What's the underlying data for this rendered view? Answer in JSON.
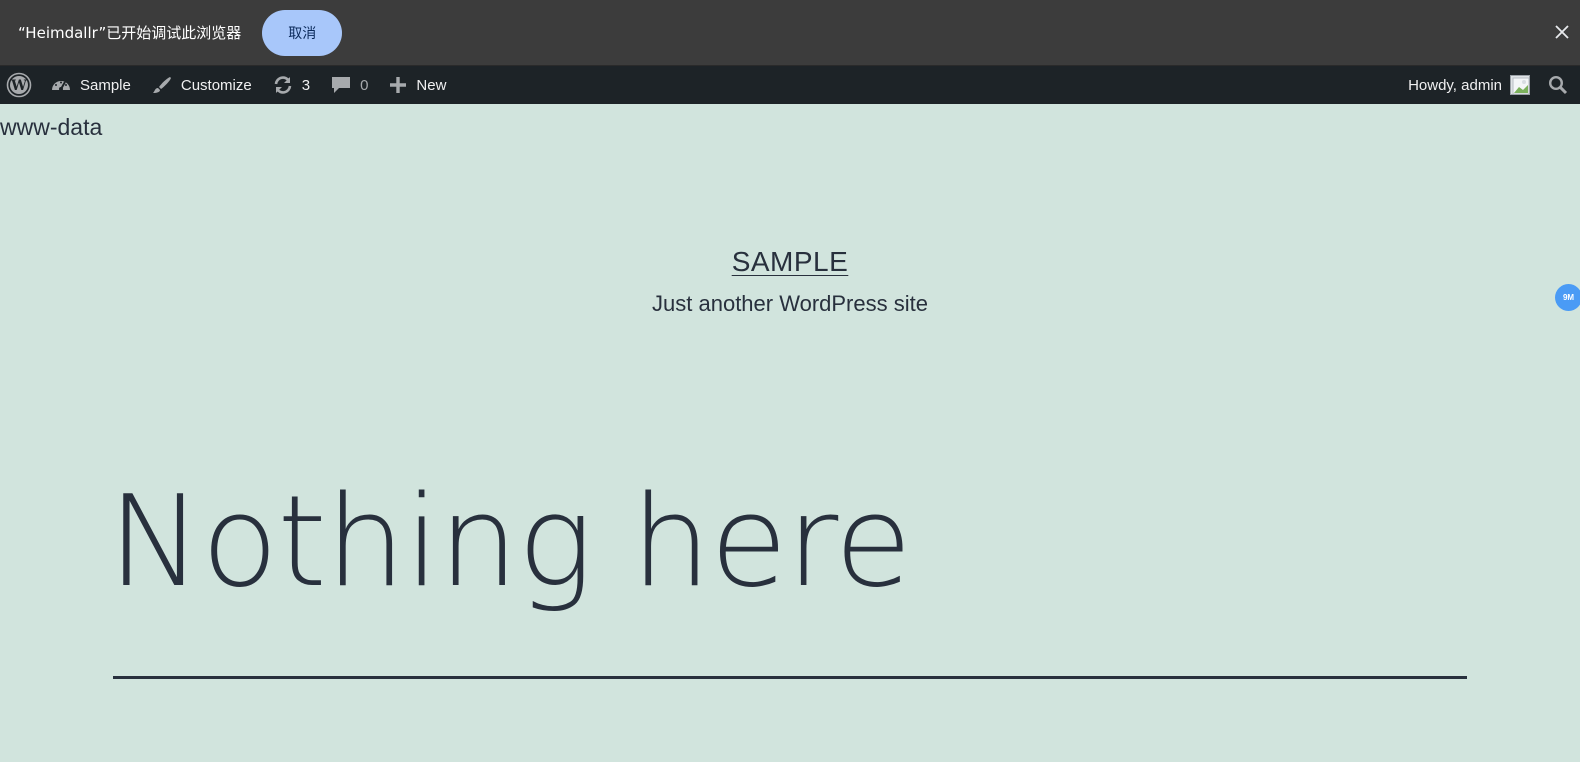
{
  "infobar": {
    "message": "“Heimdallr”已开始调试此浏览器",
    "cancel_label": "取消"
  },
  "adminbar": {
    "site_label": "Sample",
    "customize_label": "Customize",
    "updates_count": "3",
    "comments_count": "0",
    "new_label": "New",
    "howdy_label": "Howdy, admin"
  },
  "page": {
    "user_text": "www-data",
    "site_title": "SAMPLE",
    "site_description": "Just another WordPress site",
    "heading": "Nothing here",
    "side_badge": "9M"
  },
  "colors": {
    "background": "#d1e4dd",
    "adminbar": "#1d2327",
    "infobar": "#3c3c3c",
    "cancel_button": "#a8c7fa",
    "text": "#28303d"
  }
}
